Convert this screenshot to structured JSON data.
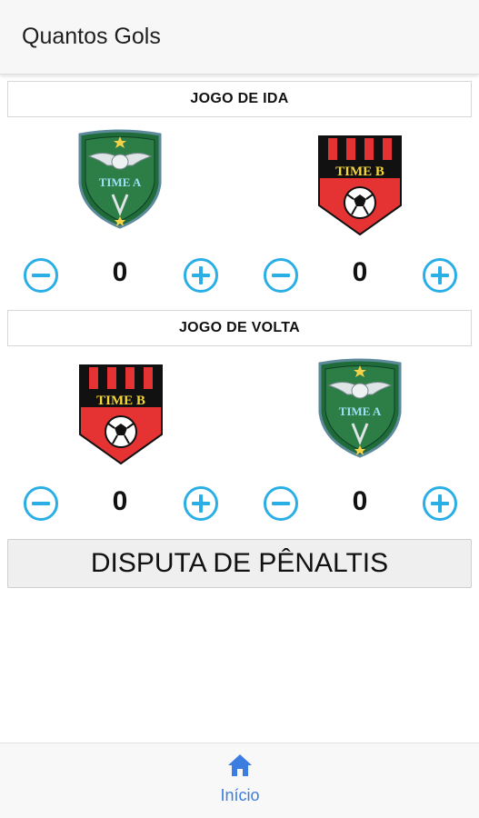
{
  "app": {
    "title": "Quantos Gols"
  },
  "first_leg": {
    "title": "JOGO DE IDA",
    "home": {
      "name": "TIME A",
      "score": "0"
    },
    "away": {
      "name": "TIME B",
      "score": "0"
    }
  },
  "second_leg": {
    "title": "JOGO DE VOLTA",
    "home": {
      "name": "TIME B",
      "score": "0"
    },
    "away": {
      "name": "TIME A",
      "score": "0"
    }
  },
  "penalty_button": "DISPUTA DE PÊNALTIS",
  "bottom_nav": {
    "home_label": "Início",
    "home_icon": "home-icon"
  },
  "colors": {
    "accent": "#2aaee6",
    "nav_active": "#3b7de0",
    "team_a_green": "#1f6b3a",
    "team_b_red": "#e53232"
  }
}
